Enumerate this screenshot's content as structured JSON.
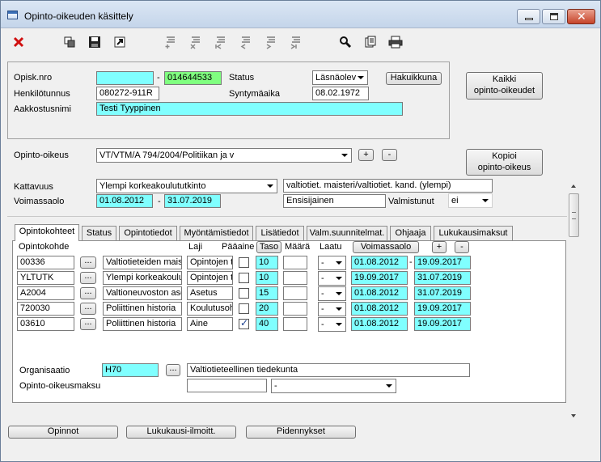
{
  "window": {
    "title": "Opinto-oikeuden käsittely"
  },
  "header": {
    "opisk_label": "Opisk.nro",
    "opisk_value1": "",
    "dash": "-",
    "opisk_value2": "014644533",
    "status_label": "Status",
    "status_value": "Läsnäolev",
    "search_button": "Hakuikkuna",
    "hetu_label": "Henkilötunnus",
    "hetu_value": "080272-911R",
    "birth_label": "Syntymäaika",
    "birth_value": "08.02.1972",
    "name_label": "Aakkostusnimi",
    "name_value": "Testi Tyyppinen",
    "all_rights_button_line1": "Kaikki",
    "all_rights_button_line2": "opinto-oikeudet"
  },
  "right": {
    "label": "Opinto-oikeus",
    "value": "VT/VTM/A 794/2004/Politiikan ja v",
    "plus": "+",
    "minus": "-",
    "copy_button_line1": "Kopioi",
    "copy_button_line2": "opinto-oikeus"
  },
  "coverage": {
    "label": "Kattavuus",
    "value": "Ylempi korkeakoulututkinto",
    "desc": "valtiotiet. maisteri/valtiotiet. kand. (ylempi)",
    "validity_label": "Voimassaolo",
    "valid_from": "01.08.2012",
    "dash": "-",
    "valid_to": "31.07.2019",
    "priority": "Ensisijainen",
    "graduated_label": "Valmistunut",
    "graduated_value": "ei"
  },
  "tabs": [
    {
      "label": "Opintokohteet",
      "active": true
    },
    {
      "label": "Status"
    },
    {
      "label": "Opintotiedot"
    },
    {
      "label": "Myöntämistiedot"
    },
    {
      "label": "Lisätiedot"
    },
    {
      "label": "Valm.suunnitelmat."
    },
    {
      "label": "Ohjaaja"
    },
    {
      "label": "Lukukausimaksut"
    }
  ],
  "grid": {
    "headers": {
      "target": "Opintokohde",
      "type": "Laji",
      "main": "Pääaine",
      "level": "Taso",
      "amount": "Määrä",
      "quality": "Laatu",
      "validity": "Voimassaolo",
      "plus": "+",
      "minus": "-"
    },
    "browse": "...",
    "dash": "-",
    "rows": [
      {
        "code": "00336",
        "name": "Valtiotieteiden maist",
        "type": "Opintojen t",
        "main": false,
        "level": "10",
        "amount": "",
        "quality": "-",
        "from": "01.08.2012",
        "to": "19.09.2017"
      },
      {
        "code": "YLTUTK",
        "name": "Ylempi korkeakoulu",
        "type": "Opintojen t",
        "main": false,
        "level": "10",
        "amount": "",
        "quality": "-",
        "from": "19.09.2017",
        "to": "31.07.2019"
      },
      {
        "code": "A2004",
        "name": "Valtioneuvoston ase",
        "type": "Asetus",
        "main": false,
        "level": "15",
        "amount": "",
        "quality": "-",
        "from": "01.08.2012",
        "to": "31.07.2019"
      },
      {
        "code": "720030",
        "name": "Poliittinen historia",
        "type": "Koulutusoh",
        "main": false,
        "level": "20",
        "amount": "",
        "quality": "-",
        "from": "01.08.2012",
        "to": "19.09.2017"
      },
      {
        "code": "03610",
        "name": "Poliittinen historia",
        "type": "Aine",
        "main": true,
        "level": "40",
        "amount": "",
        "quality": "-",
        "from": "01.08.2012",
        "to": "19.09.2017"
      }
    ]
  },
  "org": {
    "label": "Organisaatio",
    "code": "H70",
    "browse": "...",
    "name": "Valtiotieteellinen tiedekunta",
    "fee_label": "Opinto-oikeusmaksu",
    "fee_value": "",
    "fee_select": "-"
  },
  "bottom": {
    "studies": "Opinnot",
    "semester": "Lukukausi-ilmoitt.",
    "extensions": "Pidennykset"
  }
}
